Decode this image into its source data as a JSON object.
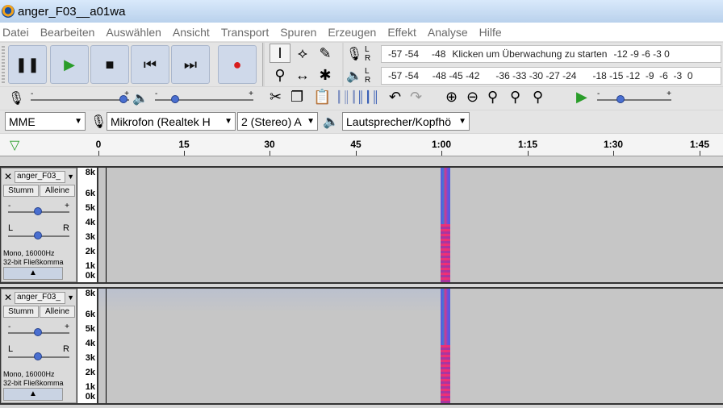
{
  "window": {
    "title": "anger_F03__a01wa"
  },
  "menu": [
    "Datei",
    "Bearbeiten",
    "Auswählen",
    "Ansicht",
    "Transport",
    "Spuren",
    "Erzeugen",
    "Effekt",
    "Analyse",
    "Hilfe"
  ],
  "transport": {
    "buttons": [
      {
        "name": "pause-button",
        "icon": "pause-icon",
        "glyph": "❚❚",
        "color": "#111111"
      },
      {
        "name": "play-button",
        "icon": "play-icon",
        "glyph": "▶",
        "color": "#2a9d2a"
      },
      {
        "name": "stop-button",
        "icon": "stop-icon",
        "glyph": "■",
        "color": "#111111"
      },
      {
        "name": "skip-start-button",
        "icon": "skip-start-icon",
        "glyph": "⏮",
        "color": "#111111"
      },
      {
        "name": "skip-end-button",
        "icon": "skip-end-icon",
        "glyph": "⏭",
        "color": "#111111"
      },
      {
        "name": "record-button",
        "icon": "record-icon",
        "glyph": "●",
        "color": "#d81c1c"
      }
    ]
  },
  "meters": {
    "record": {
      "L": "L",
      "R": "R",
      "left_ticks": "-57 -54",
      "mid_tick": "-48",
      "prompt": "Klicken um Überwachung zu starten",
      "right_ticks": "-12  -9  -6  -3  0"
    },
    "playback": {
      "L": "L",
      "R": "R",
      "ticks": "-57 -54     -48 -45 -42      -36 -33 -30 -27 -24      -18 -15 -12  -9  -6  -3  0"
    }
  },
  "devices": {
    "host": "MME",
    "input": "Mikrofon (Realtek H",
    "channels": "2 (Stereo) A",
    "output": "Lautsprecher/Kopfhö"
  },
  "timeline": {
    "labels": [
      "0",
      "15",
      "30",
      "45",
      "1:00",
      "1:15",
      "1:30",
      "1:45"
    ]
  },
  "tracks": [
    {
      "name": "anger_F03_",
      "mute": "Stumm",
      "solo": "Alleine",
      "pan_left": "L",
      "pan_right": "R",
      "format_line1": "Mono, 16000Hz",
      "format_line2": "32-bit Fließkomma",
      "ruler": [
        "8k",
        "6k",
        "5k",
        "4k",
        "3k",
        "2k",
        "1k",
        "0k"
      ]
    },
    {
      "name": "anger_F03_",
      "mute": "Stumm",
      "solo": "Alleine",
      "pan_left": "L",
      "pan_right": "R",
      "format_line1": "Mono, 16000Hz",
      "format_line2": "32-bit Fließkomma",
      "ruler": [
        "8k",
        "6k",
        "5k",
        "4k",
        "3k",
        "2k",
        "1k",
        "0k"
      ]
    }
  ]
}
